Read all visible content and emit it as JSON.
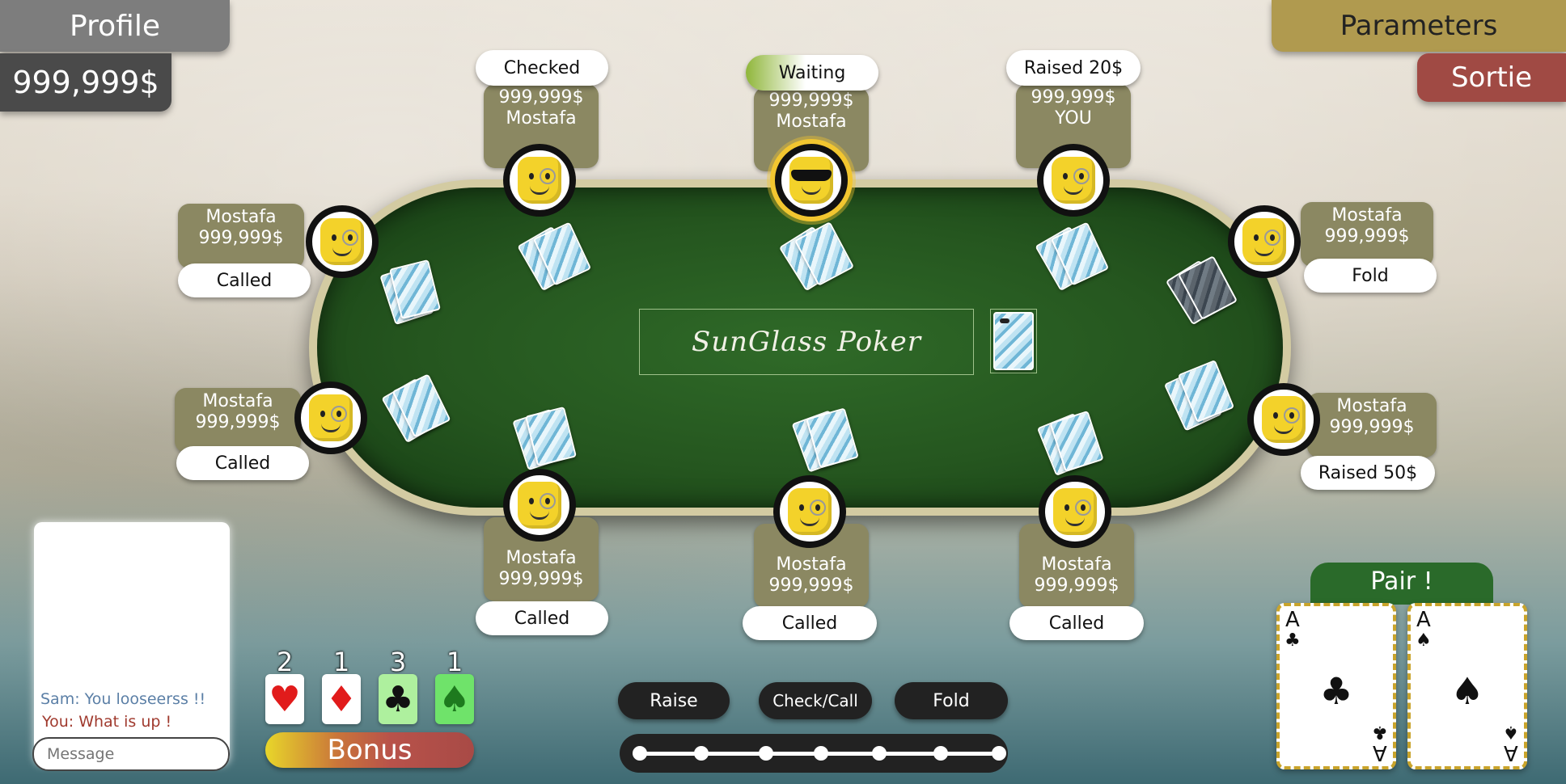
{
  "header": {
    "profile_label": "Profile",
    "balance": "999,999$",
    "parameters_label": "Parameters",
    "exit_label": "Sortie"
  },
  "table": {
    "logo": "SunGlass Poker"
  },
  "seats": {
    "top_left": {
      "status": "Checked",
      "chips": "999,999$",
      "name": "Mostafa"
    },
    "top_center": {
      "status": "Waiting",
      "chips": "999,999$",
      "name": "Mostafa"
    },
    "top_right": {
      "status": "Raised 20$",
      "chips": "999,999$",
      "name": "YOU"
    },
    "left_upper": {
      "status": "Called",
      "chips": "999,999$",
      "name": "Mostafa"
    },
    "left_lower": {
      "status": "Called",
      "chips": "999,999$",
      "name": "Mostafa"
    },
    "right_upper": {
      "status": "Fold",
      "chips": "999,999$",
      "name": "Mostafa"
    },
    "right_lower": {
      "status": "Raised 50$",
      "chips": "999,999$",
      "name": "Mostafa"
    },
    "bottom_left": {
      "status": "Called",
      "chips": "999,999$",
      "name": "Mostafa"
    },
    "bottom_center": {
      "status": "Called",
      "chips": "999,999$",
      "name": "Mostafa"
    },
    "bottom_right": {
      "status": "Called",
      "chips": "999,999$",
      "name": "Mostafa"
    }
  },
  "chat": {
    "messages": [
      {
        "text": "Sam: You looseerss !!",
        "color": "#5b7fa6"
      },
      {
        "text": "You: What is up !",
        "color": "#a03a2e"
      }
    ],
    "placeholder": "Message"
  },
  "bonus": {
    "counts": {
      "hearts": "2",
      "diamonds": "1",
      "clubs": "3",
      "spades": "1"
    },
    "label": "Bonus"
  },
  "actions": {
    "raise": "Raise",
    "check_call": "Check/Call",
    "fold": "Fold",
    "slider_positions": 7
  },
  "hand": {
    "combo": "Pair !",
    "cards": [
      {
        "rank": "A",
        "suit": "♣"
      },
      {
        "rank": "A",
        "suit": "♠"
      }
    ]
  },
  "colors": {
    "felt": "#25561f",
    "seat_panel": "#8b8862",
    "parameters": "#b09a4f",
    "exit": "#a04a44",
    "profile": "#7a7a7a"
  }
}
